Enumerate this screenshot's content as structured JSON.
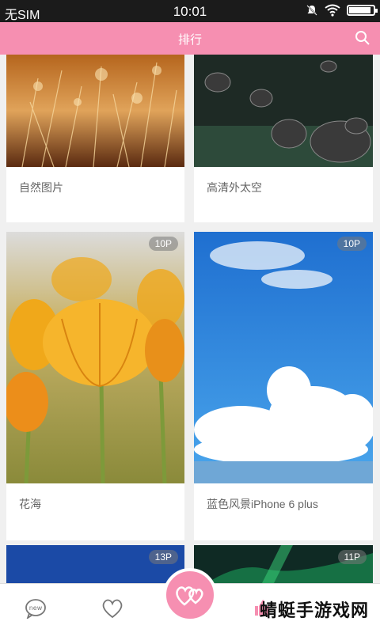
{
  "status_bar": {
    "carrier": "无SIM",
    "time": "10:01",
    "battery_level": 0.9
  },
  "header": {
    "title": "排行"
  },
  "cards": [
    {
      "label": "自然图片",
      "badge": ""
    },
    {
      "label": "高清外太空",
      "badge": ""
    },
    {
      "label": "花海",
      "badge": "10P"
    },
    {
      "label": "蓝色风景iPhone 6 plus",
      "badge": "10P"
    },
    {
      "label": "",
      "badge": "13P"
    },
    {
      "label": "",
      "badge": "11P"
    }
  ],
  "watermark": "蜻蜓手游戏网",
  "icons": [
    "new-icon",
    "heart-icon",
    "love-logo-icon",
    "thumb-up-icon"
  ]
}
